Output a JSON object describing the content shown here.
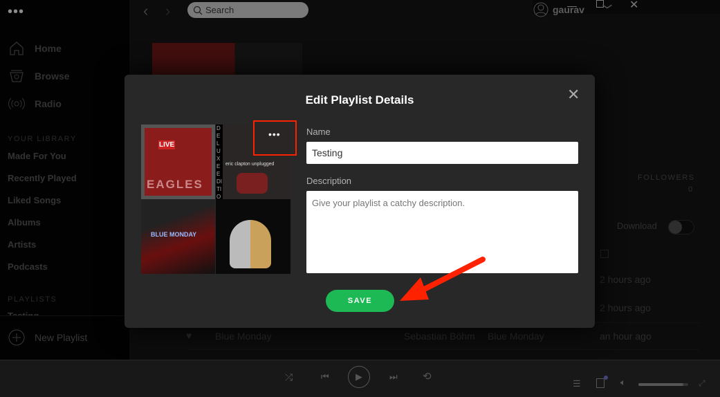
{
  "app": {
    "menu_icon": "ellipsis-icon"
  },
  "sidebar": {
    "nav": [
      {
        "label": "Home",
        "icon": "home-icon"
      },
      {
        "label": "Browse",
        "icon": "browse-icon"
      },
      {
        "label": "Radio",
        "icon": "radio-icon"
      }
    ],
    "library_heading": "YOUR LIBRARY",
    "library": [
      "Made For You",
      "Recently Played",
      "Liked Songs",
      "Albums",
      "Artists",
      "Podcasts"
    ],
    "playlists_heading": "PLAYLISTS",
    "playlists": [
      "Testing"
    ],
    "new_playlist": "New Playlist"
  },
  "topbar": {
    "search_placeholder": "Search",
    "user": "gaurav"
  },
  "playlist": {
    "followers_label": "FOLLOWERS",
    "followers": "0",
    "download_label": "Download",
    "download_on": false,
    "rows": [
      {
        "title": "",
        "artist": "",
        "album": "",
        "added": "2 hours ago"
      },
      {
        "title": "",
        "artist": "",
        "album": "",
        "added": "2 hours ago"
      },
      {
        "title": "Blue Monday",
        "artist": "Sebastian Böhm",
        "album": "Blue Monday",
        "added": "an hour ago"
      }
    ]
  },
  "modal": {
    "title": "Edit Playlist Details",
    "name_label": "Name",
    "name_value": "Testing",
    "description_label": "Description",
    "description_placeholder": "Give your playlist a catchy description.",
    "save_label": "SAVE",
    "cover_texts": {
      "eagles": "EAGLES",
      "live": "LIVE",
      "deluxe": "DELUXE EDITION",
      "unplugged": "eric clapton unplugged",
      "blue": "BLUE MONDAY"
    }
  },
  "colors": {
    "accent": "#1db954",
    "annotation": "#ff2200"
  },
  "player": {
    "volume": 0.9
  }
}
